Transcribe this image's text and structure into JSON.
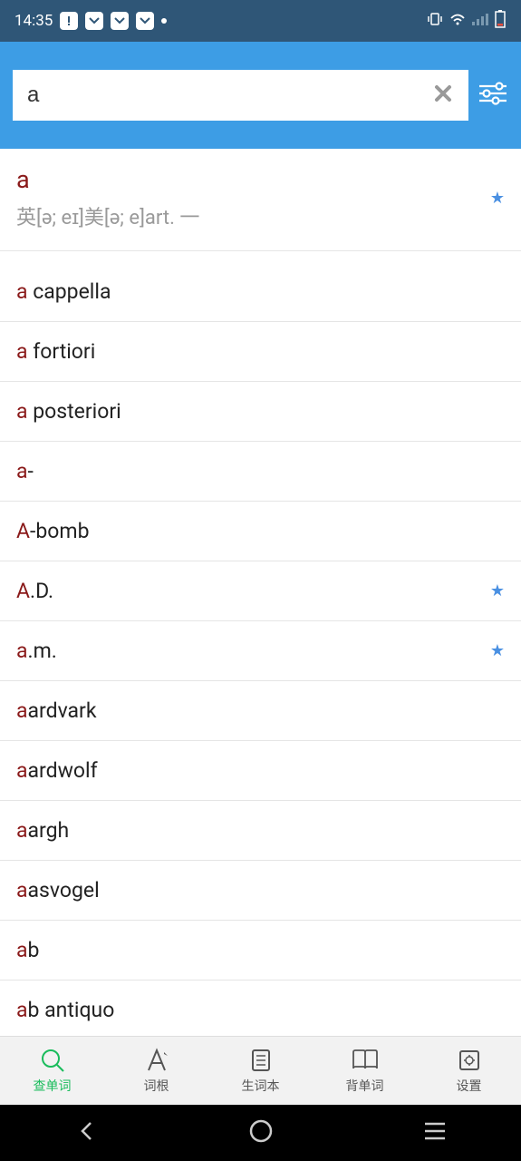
{
  "statusbar": {
    "time": "14:35"
  },
  "search": {
    "value": "a"
  },
  "entry": {
    "word": "a",
    "phonetic": "英[ə; eɪ]美[ə; e]art. 一",
    "starred": true
  },
  "list": [
    {
      "highlight": "a",
      "rest": " cappella",
      "starred": false
    },
    {
      "highlight": "a",
      "rest": " fortiori",
      "starred": false
    },
    {
      "highlight": "a",
      "rest": " posteriori",
      "starred": false
    },
    {
      "highlight": "a",
      "rest": "-",
      "starred": false
    },
    {
      "highlight": "A",
      "rest": "-bomb",
      "starred": false
    },
    {
      "highlight": "A",
      "rest": ".D.",
      "starred": true
    },
    {
      "highlight": "a",
      "rest": ".m.",
      "starred": true
    },
    {
      "highlight": "a",
      "rest": "ardvark",
      "starred": false
    },
    {
      "highlight": "a",
      "rest": "ardwolf",
      "starred": false
    },
    {
      "highlight": "a",
      "rest": "argh",
      "starred": false
    },
    {
      "highlight": "a",
      "rest": "asvogel",
      "starred": false
    },
    {
      "highlight": "a",
      "rest": "b",
      "starred": false
    },
    {
      "highlight": "a",
      "rest": "b antiquo",
      "starred": false
    }
  ],
  "nav": {
    "items": [
      {
        "label": "查单词",
        "active": true
      },
      {
        "label": "词根",
        "active": false
      },
      {
        "label": "生词本",
        "active": false
      },
      {
        "label": "背单词",
        "active": false
      },
      {
        "label": "设置",
        "active": false
      }
    ]
  }
}
